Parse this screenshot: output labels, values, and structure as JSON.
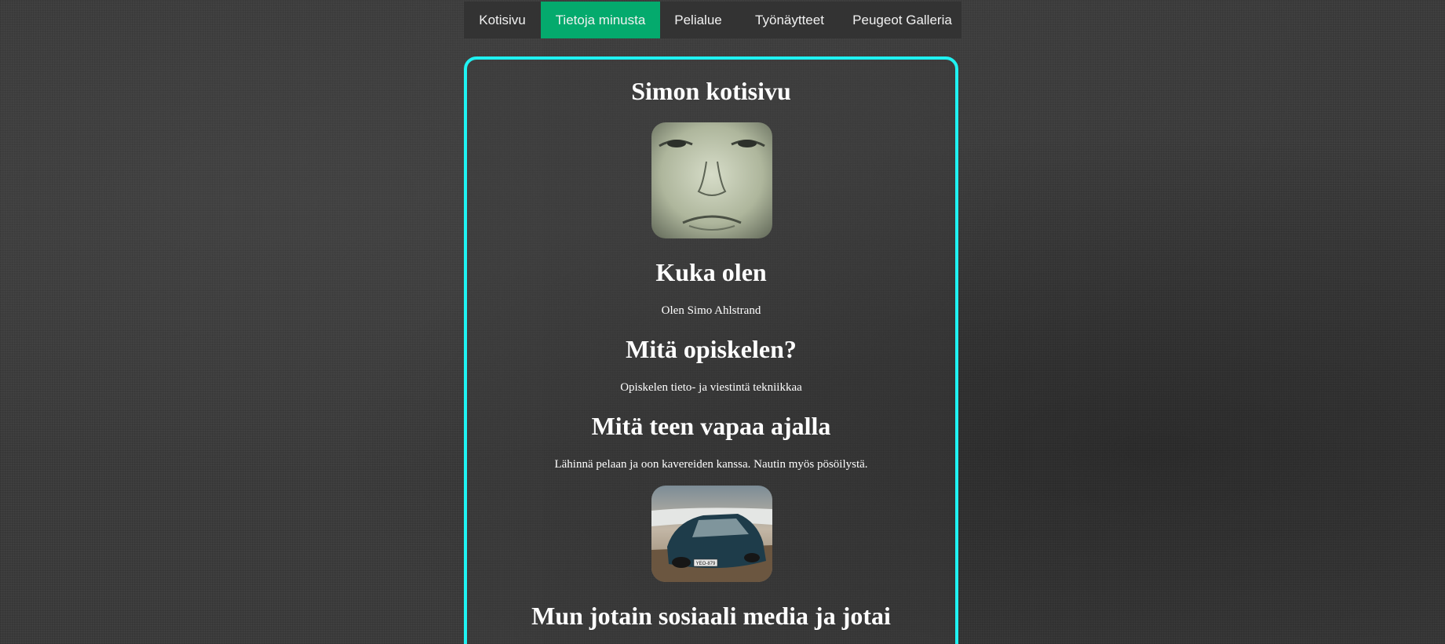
{
  "nav": {
    "items": [
      {
        "label": "Kotisivu",
        "active": false
      },
      {
        "label": "Tietoja minusta",
        "active": true
      },
      {
        "label": "Pelialue",
        "active": false
      },
      {
        "label": "Työnäytteet",
        "active": false
      },
      {
        "label": "Peugeot Galleria",
        "active": false
      }
    ]
  },
  "colors": {
    "nav_bg": "#333333",
    "nav_active": "#04aa6d",
    "panel_border": "#1ff2f2",
    "text": "#ffffff"
  },
  "content": {
    "title": "Simon kotisivu",
    "section1": {
      "heading": "Kuka olen",
      "text": "Olen Simo Ahlstrand"
    },
    "section2": {
      "heading": "Mitä opiskelen?",
      "text": "Opiskelen tieto- ja viestintä tekniikkaa"
    },
    "section3": {
      "heading": "Mitä teen vapaa ajalla",
      "text": "Lähinnä pelaan ja oon kavereiden kanssa. Nautin myös pösöilystä."
    },
    "section4": {
      "heading": "Mun jotain sosiaali media ja jotai"
    },
    "car_plate": "YEO-879"
  }
}
